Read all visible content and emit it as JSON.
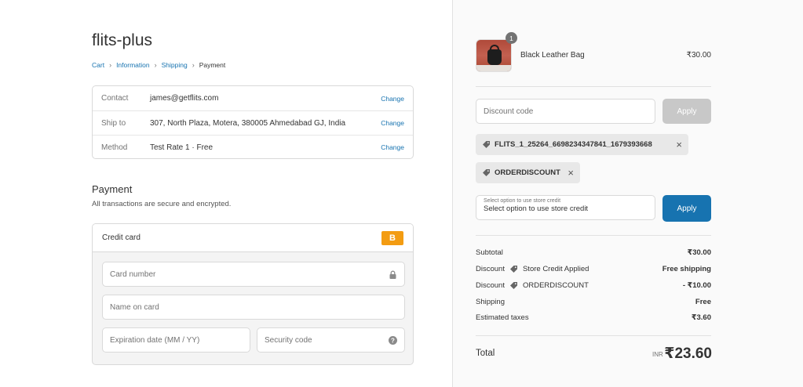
{
  "shop": {
    "title": "flits-plus"
  },
  "breadcrumb": {
    "items": [
      "Cart",
      "Information",
      "Shipping",
      "Payment"
    ]
  },
  "review": {
    "rows": [
      {
        "label": "Contact",
        "value": "james@getflits.com",
        "action": "Change"
      },
      {
        "label": "Ship to",
        "value": "307, North Plaza, Motera, 380005 Ahmedabad GJ, India",
        "action": "Change"
      },
      {
        "label": "Method",
        "value": "Test Rate 1 · Free",
        "action": "Change"
      }
    ]
  },
  "payment": {
    "heading": "Payment",
    "subheading": "All transactions are secure and encrypted.",
    "method_label": "Credit card",
    "brand_badge": "B",
    "fields": {
      "card_number": "Card number",
      "name_on_card": "Name on card",
      "expiration": "Expiration date (MM / YY)",
      "security_code": "Security code"
    }
  },
  "order": {
    "item": {
      "name": "Black Leather Bag",
      "price": "₹30.00",
      "quantity": "1"
    },
    "discount": {
      "placeholder": "Discount code",
      "apply_label": "Apply",
      "applied": [
        {
          "code": "FLITS_1_25264_6698234347841_1679393668"
        },
        {
          "code": "ORDERDISCOUNT"
        }
      ]
    },
    "store_credit": {
      "label_small": "Select option to use store credit",
      "value": "Select option to use store credit",
      "apply_label": "Apply"
    },
    "summary": {
      "subtotal": {
        "label": "Subtotal",
        "value": "₹30.00"
      },
      "discount1": {
        "label": "Discount",
        "tag": "Store Credit Applied",
        "value": "Free shipping"
      },
      "discount2": {
        "label": "Discount",
        "tag": "ORDERDISCOUNT",
        "value": "- ₹10.00"
      },
      "shipping": {
        "label": "Shipping",
        "value": "Free"
      },
      "taxes": {
        "label": "Estimated taxes",
        "value": "₹3.60"
      }
    },
    "total": {
      "label": "Total",
      "currency": "INR",
      "value": "₹23.60"
    }
  },
  "colors": {
    "accent": "#1773b0",
    "badge": "#f39c12",
    "disabled": "#c8c8c8"
  },
  "icons": [
    "chevron-right-icon",
    "lock-icon",
    "help-icon",
    "tag-icon",
    "close-icon"
  ]
}
